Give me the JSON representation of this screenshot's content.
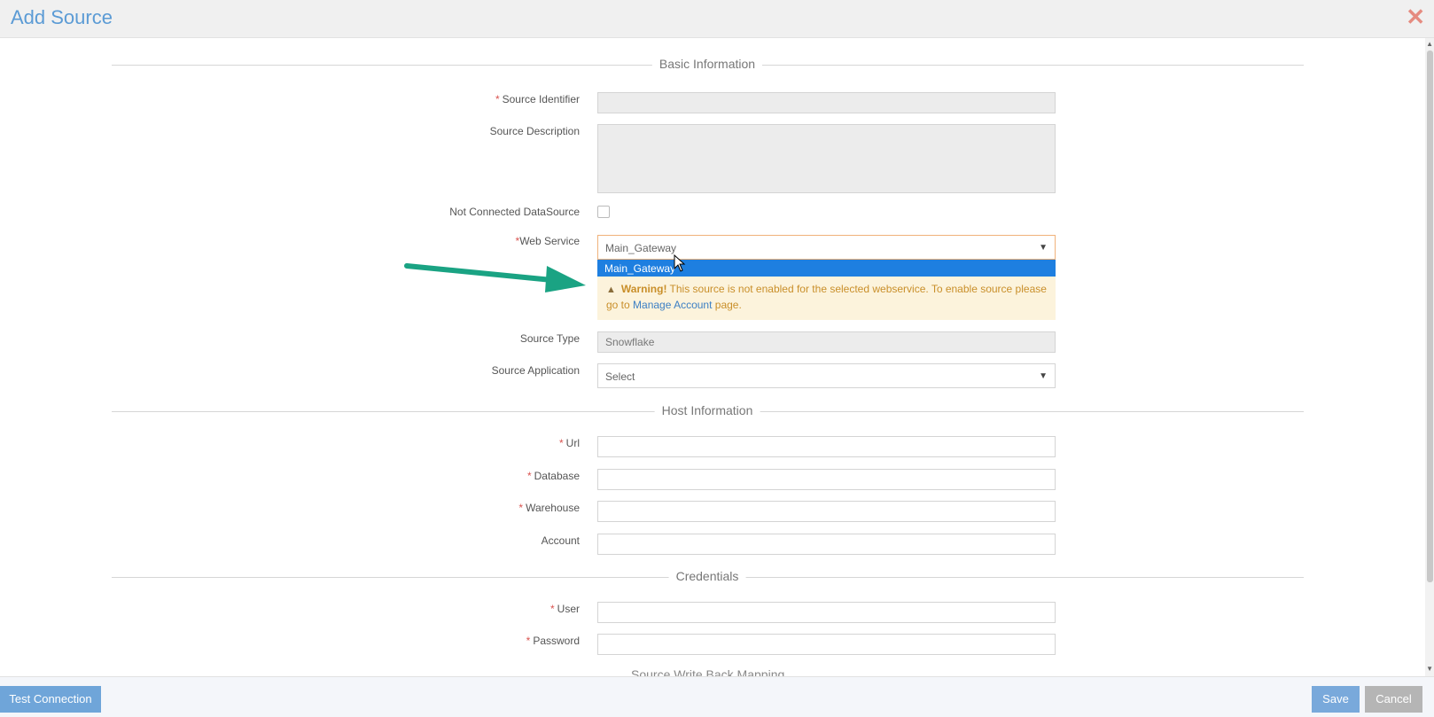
{
  "window": {
    "title": "Add Source",
    "close_icon": "close-icon"
  },
  "sections": {
    "basic": "Basic Information",
    "host": "Host Information",
    "credentials": "Credentials",
    "writeback": "Source Write Back Mapping"
  },
  "fields": {
    "source_identifier": {
      "label": "Source Identifier",
      "required": "*",
      "value": ""
    },
    "source_description": {
      "label": "Source Description",
      "value": ""
    },
    "not_connected": {
      "label": "Not Connected DataSource",
      "checked": false
    },
    "web_service": {
      "label": "Web Service",
      "required": "*",
      "value": "Main_Gateway",
      "option": "Main_Gateway"
    },
    "source_type": {
      "label": "Source Type",
      "value": "Snowflake"
    },
    "source_application": {
      "label": "Source Application",
      "value": "Select"
    },
    "url": {
      "label": "Url",
      "required": "*",
      "value": ""
    },
    "database": {
      "label": "Database",
      "required": "*",
      "value": ""
    },
    "warehouse": {
      "label": "Warehouse",
      "required": "*",
      "value": ""
    },
    "account": {
      "label": "Account",
      "value": ""
    },
    "user": {
      "label": "User",
      "required": "*",
      "value": ""
    },
    "password": {
      "label": "Password",
      "required": "*",
      "value": ""
    }
  },
  "warning": {
    "title": "Warning!",
    "text": " This source is not enabled for the selected webservice. To enable source please go to ",
    "link": "Manage Account",
    "suffix": " page."
  },
  "footer": {
    "test_connection": "Test Connection",
    "save": "Save",
    "cancel": "Cancel"
  },
  "colors": {
    "accent": "#5b9bd5",
    "warning_bg": "#fcf3dc",
    "arrow": "#1aa383",
    "selected_option": "#1e7fe0"
  }
}
